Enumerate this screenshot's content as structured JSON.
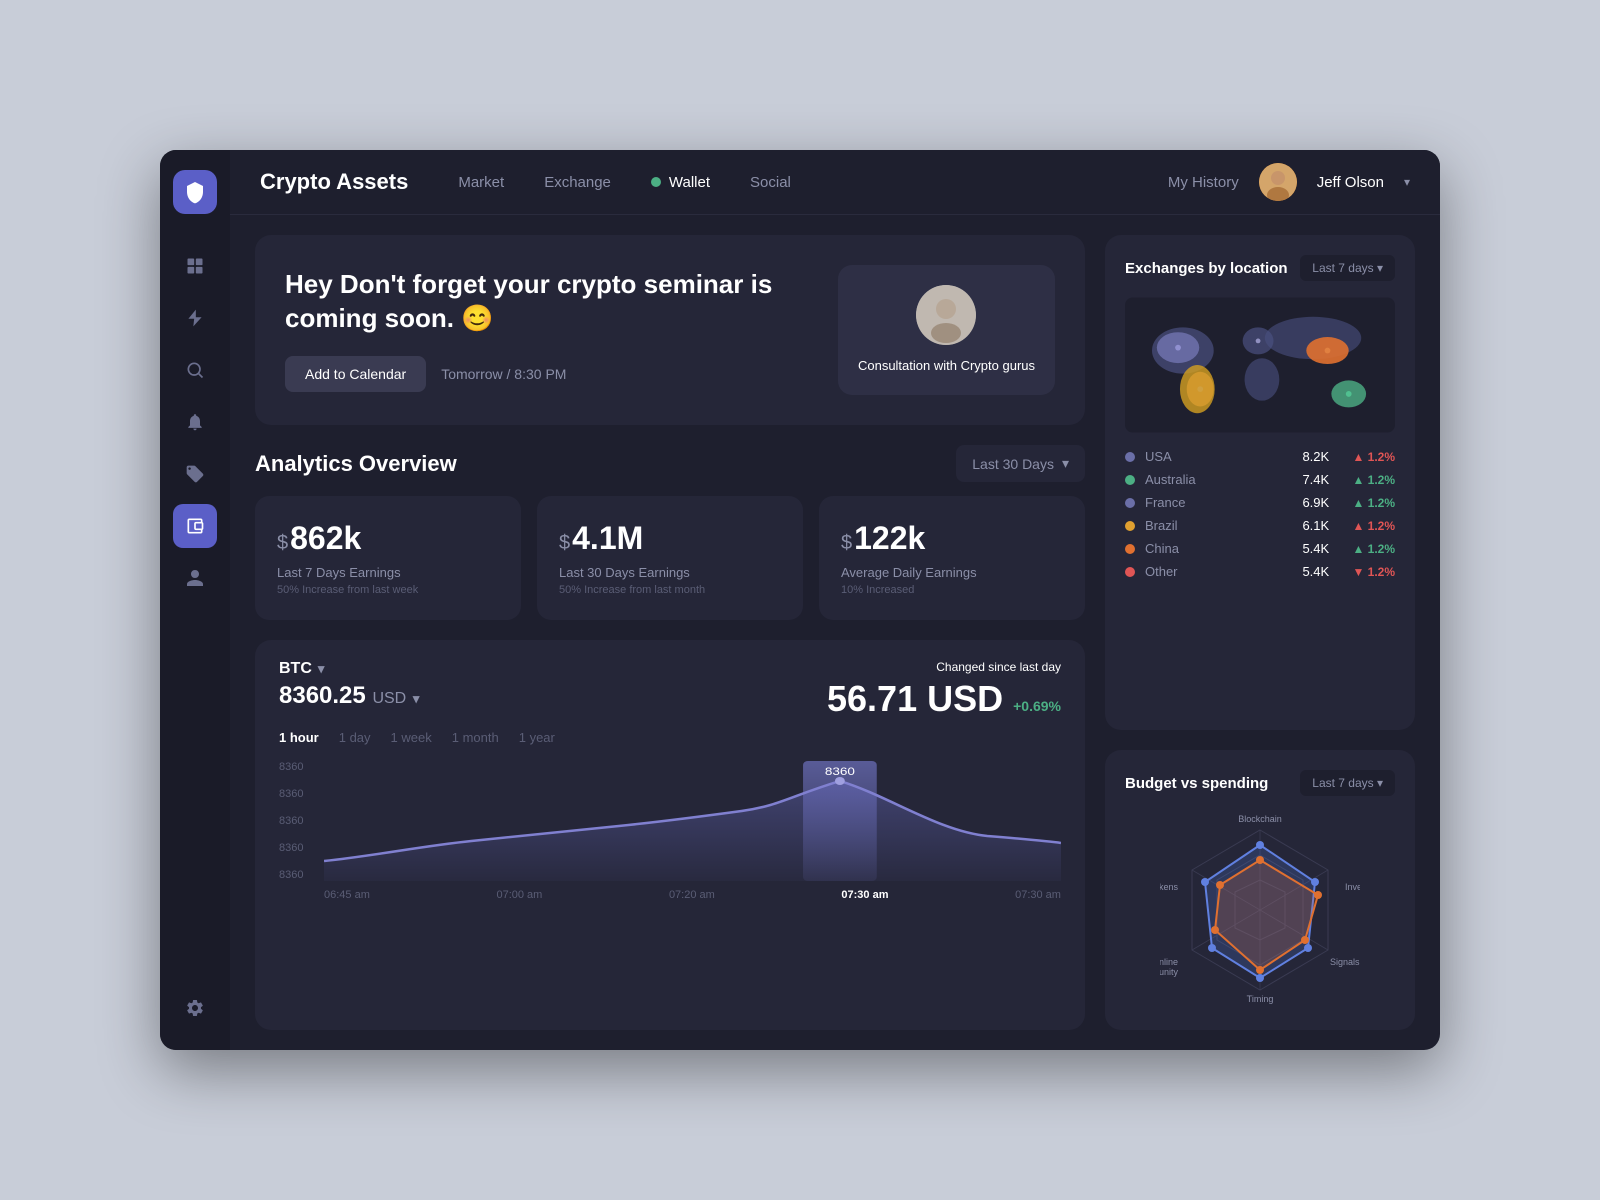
{
  "app": {
    "title": "Crypto Assets",
    "logo_icon": "shield-icon"
  },
  "sidebar": {
    "items": [
      {
        "id": "grid",
        "icon": "grid-icon",
        "active": false
      },
      {
        "id": "lightning",
        "icon": "lightning-icon",
        "active": false
      },
      {
        "id": "search",
        "icon": "search-icon",
        "active": false
      },
      {
        "id": "bell",
        "icon": "bell-icon",
        "active": false
      },
      {
        "id": "tag",
        "icon": "tag-icon",
        "active": false
      },
      {
        "id": "wallet-nav",
        "icon": "wallet-icon",
        "active": true
      },
      {
        "id": "user",
        "icon": "user-icon",
        "active": false
      }
    ],
    "settings_icon": "gear-icon"
  },
  "header": {
    "title": "Crypto Assets",
    "nav_items": [
      {
        "label": "Market",
        "active": false
      },
      {
        "label": "Exchange",
        "active": false
      },
      {
        "label": "Wallet",
        "active": true
      },
      {
        "label": "Social",
        "active": false
      }
    ],
    "my_history": "My History",
    "user": {
      "name": "Jeff Olson",
      "chevron": "▾"
    }
  },
  "banner": {
    "heading": "Hey Don't forget your crypto seminar is coming soon. 😊",
    "btn_calendar": "Add to Calendar",
    "btn_date": "Tomorrow / 8:30 PM",
    "card": {
      "title": "Consultation with Crypto gurus"
    }
  },
  "analytics": {
    "title": "Analytics Overview",
    "period": "Last 30 Days",
    "stats": [
      {
        "currency_symbol": "$",
        "value": "862k",
        "label": "Last 7 Days Earnings",
        "sublabel": "50% Increase from last week"
      },
      {
        "currency_symbol": "$",
        "value": "4.1M",
        "label": "Last 30 Days Earnings",
        "sublabel": "50% Increase from last month"
      },
      {
        "currency_symbol": "$",
        "value": "122k",
        "label": "Average Daily Earnings",
        "sublabel": "10% Increased"
      }
    ]
  },
  "chart": {
    "currency": "BTC",
    "price": "8360.25",
    "price_unit": "USD",
    "changed_since_label": "Changed since",
    "changed_since_period": "last day",
    "big_value": "56.71 USD",
    "change_percent": "+0.69%",
    "time_tabs": [
      "1 hour",
      "1 day",
      "1 week",
      "1 month",
      "1 year"
    ],
    "active_tab": "1 hour",
    "y_labels": [
      "8360",
      "8360",
      "8360",
      "8360",
      "8360"
    ],
    "x_labels": [
      "06:45 am",
      "07:00 am",
      "07:20 am",
      "07:30 am",
      "07:30 am"
    ],
    "active_x": "07:30 am",
    "peak_label": "8360"
  },
  "exchanges": {
    "title": "Exchanges by location",
    "period": "Last 7 days",
    "countries": [
      {
        "name": "USA",
        "value": "8.2K",
        "change": "▲ 1.2%",
        "positive": false,
        "color": "#6b6fa8"
      },
      {
        "name": "Australia",
        "value": "7.4K",
        "change": "▲ 1.2%",
        "positive": true,
        "color": "#4caf84"
      },
      {
        "name": "France",
        "value": "6.9K",
        "change": "▲ 1.2%",
        "positive": true,
        "color": "#6b6fa8"
      },
      {
        "name": "Brazil",
        "value": "6.1K",
        "change": "▲ 1.2%",
        "positive": false,
        "color": "#e0a030"
      },
      {
        "name": "China",
        "value": "5.4K",
        "change": "▲ 1.2%",
        "positive": true,
        "color": "#e07030"
      },
      {
        "name": "Other",
        "value": "5.4K",
        "change": "▼ 1.2%",
        "positive": false,
        "color": "#e05555"
      }
    ]
  },
  "budget": {
    "title": "Budget vs spending",
    "period": "Last 7 days",
    "radar_labels": [
      "Blockchain",
      "Investment",
      "Signals",
      "Timing",
      "Online Community",
      "Digital Tokens"
    ]
  }
}
